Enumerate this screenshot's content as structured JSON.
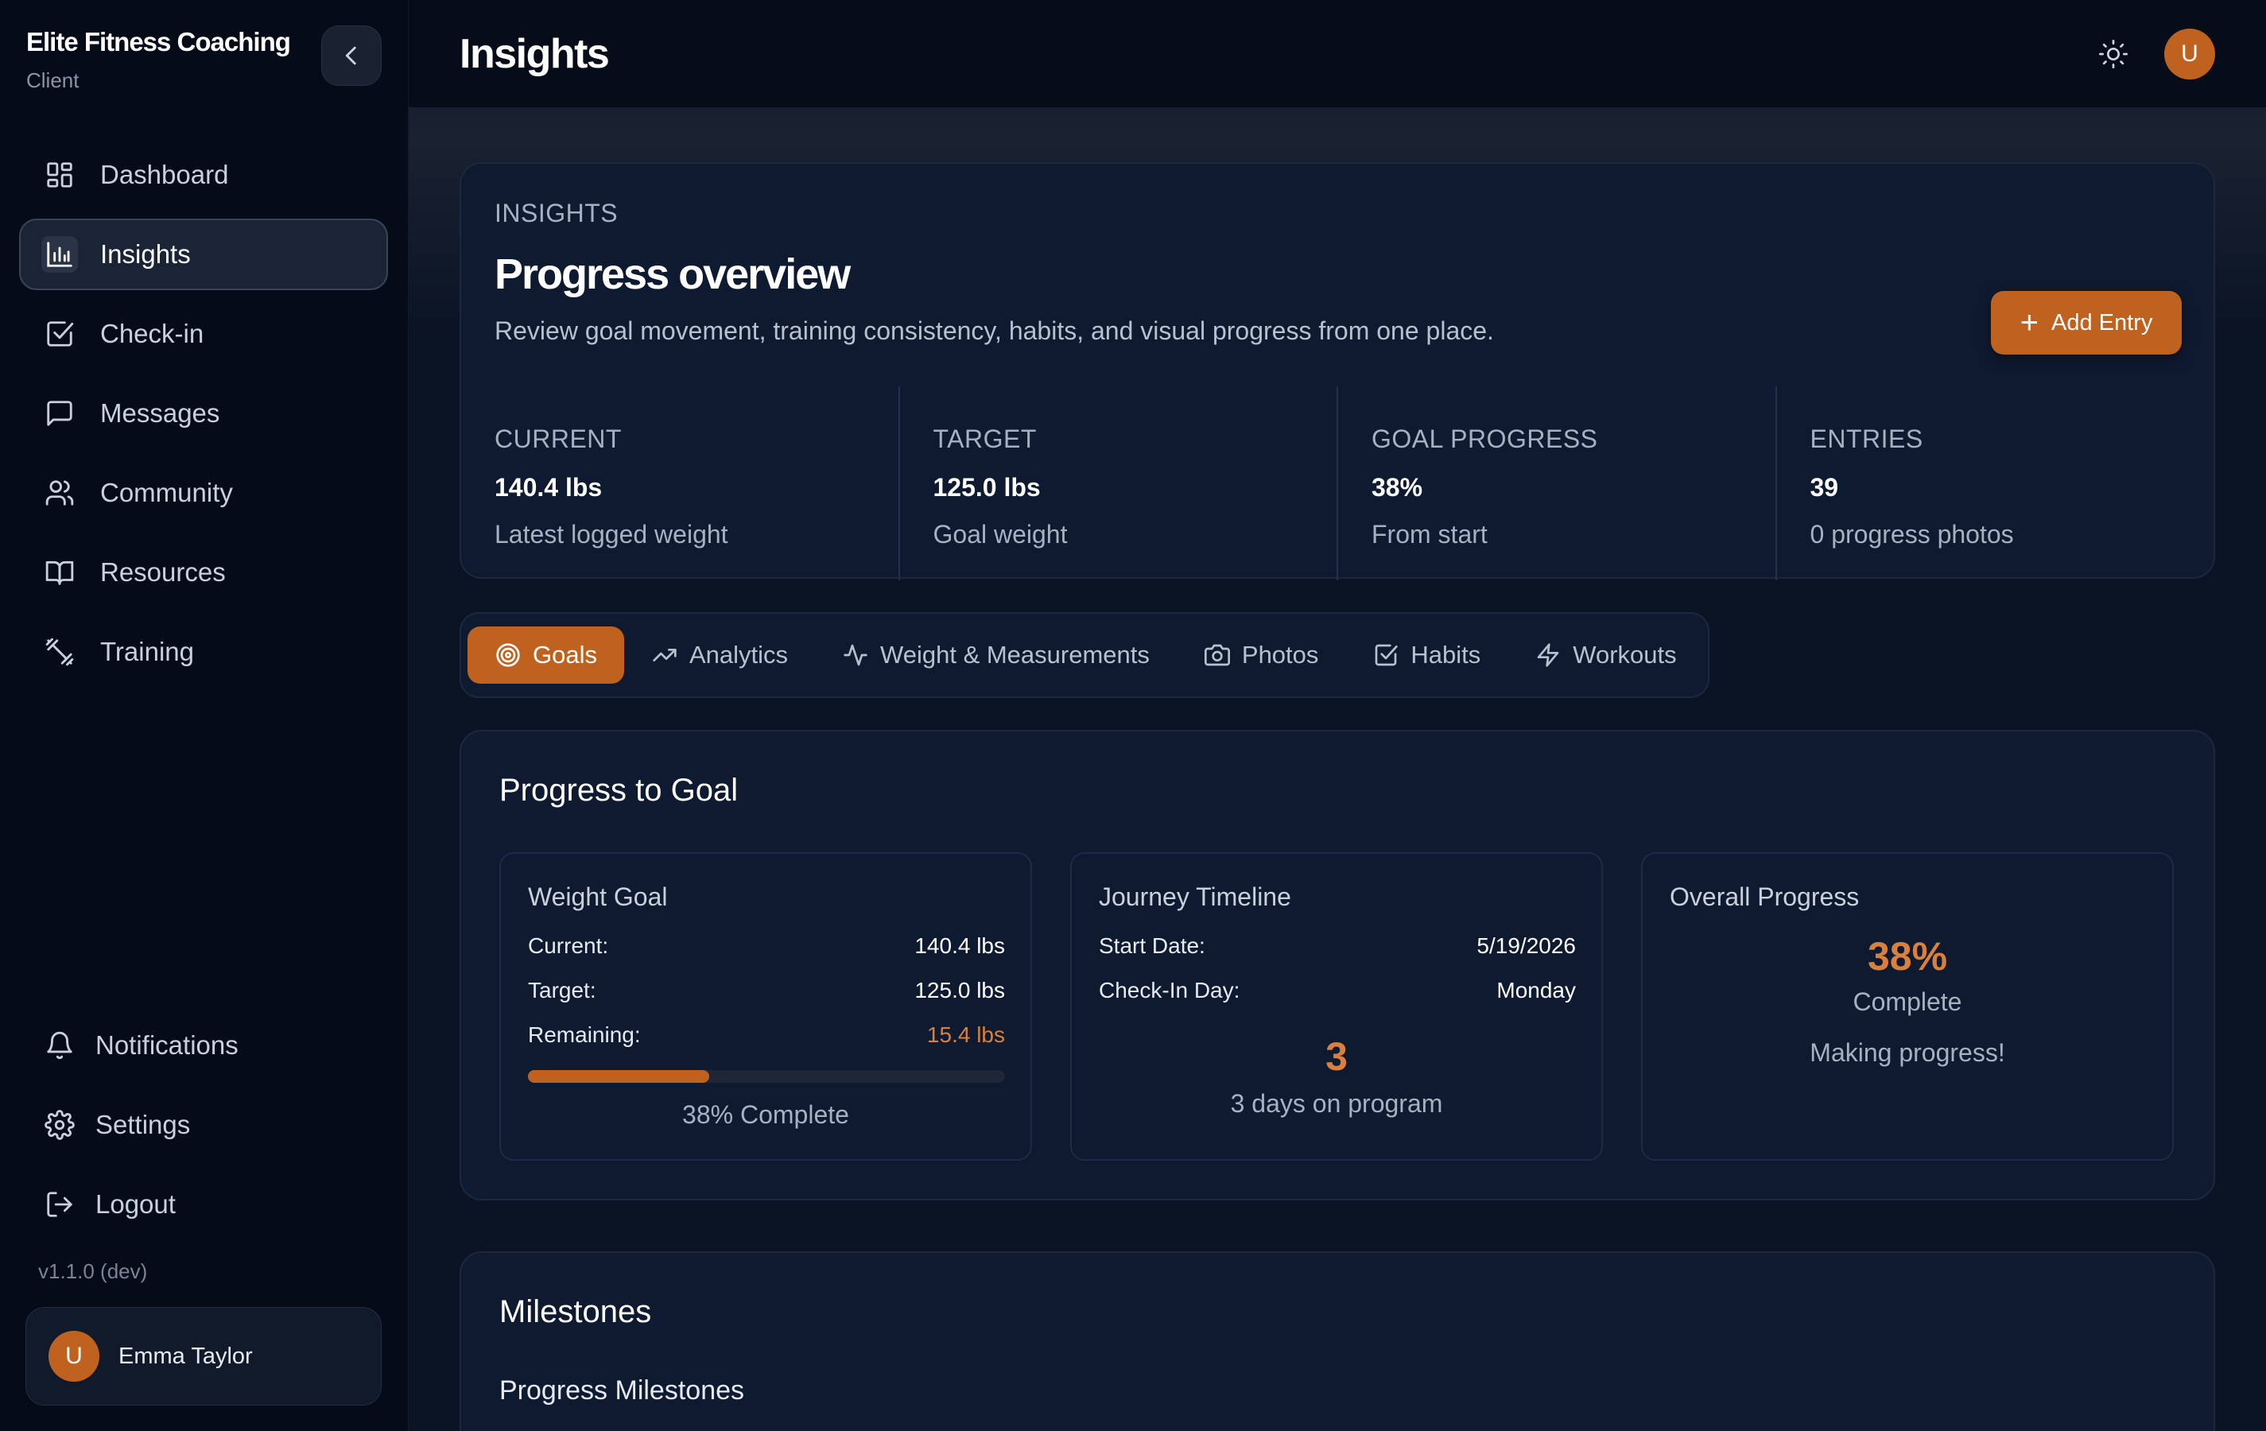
{
  "brand": {
    "name": "Elite Fitness Coaching",
    "role": "Client"
  },
  "sidebar": {
    "items": [
      {
        "label": "Dashboard",
        "icon": "dashboard-icon"
      },
      {
        "label": "Insights",
        "icon": "bar-chart-icon",
        "active": true
      },
      {
        "label": "Check-in",
        "icon": "checkbox-icon"
      },
      {
        "label": "Messages",
        "icon": "message-icon"
      },
      {
        "label": "Community",
        "icon": "users-icon"
      },
      {
        "label": "Resources",
        "icon": "book-icon"
      },
      {
        "label": "Training",
        "icon": "dumbbell-icon"
      }
    ],
    "bottom_items": [
      {
        "label": "Notifications",
        "icon": "bell-icon"
      },
      {
        "label": "Settings",
        "icon": "gear-icon"
      },
      {
        "label": "Logout",
        "icon": "logout-icon"
      }
    ],
    "version": "v1.1.0 (dev)",
    "user": {
      "initial": "U",
      "name": "Emma Taylor"
    }
  },
  "header": {
    "title": "Insights",
    "avatar_initial": "U"
  },
  "overview": {
    "eyebrow": "INSIGHTS",
    "title": "Progress overview",
    "description": "Review goal movement, training consistency, habits, and visual progress from one place.",
    "add_button": "Add Entry",
    "stats": [
      {
        "label": "CURRENT",
        "value": "140.4 lbs",
        "sub": "Latest logged weight"
      },
      {
        "label": "TARGET",
        "value": "125.0 lbs",
        "sub": "Goal weight"
      },
      {
        "label": "GOAL PROGRESS",
        "value": "38%",
        "sub": "From start"
      },
      {
        "label": "ENTRIES",
        "value": "39",
        "sub": "0 progress photos"
      }
    ]
  },
  "tabs": [
    {
      "label": "Goals",
      "icon": "target-icon",
      "active": true
    },
    {
      "label": "Analytics",
      "icon": "trending-up-icon"
    },
    {
      "label": "Weight & Measurements",
      "icon": "activity-icon"
    },
    {
      "label": "Photos",
      "icon": "camera-icon"
    },
    {
      "label": "Habits",
      "icon": "checkbox-icon"
    },
    {
      "label": "Workouts",
      "icon": "lightning-icon"
    }
  ],
  "goal": {
    "title": "Progress to Goal",
    "weight_goal": {
      "title": "Weight Goal",
      "current_label": "Current:",
      "current_value": "140.4 lbs",
      "target_label": "Target:",
      "target_value": "125.0 lbs",
      "remaining_label": "Remaining:",
      "remaining_value": "15.4 lbs",
      "progress_fraction": 0.38,
      "progress_text": "38% Complete"
    },
    "timeline": {
      "title": "Journey Timeline",
      "start_label": "Start Date:",
      "start_value": "5/19/2026",
      "checkin_label": "Check-In Day:",
      "checkin_value": "Monday",
      "days": "3",
      "days_text": "3 days on program"
    },
    "overall": {
      "title": "Overall Progress",
      "percent": "38%",
      "complete": "Complete",
      "message": "Making progress!"
    }
  },
  "milestones": {
    "title": "Milestones",
    "subtitle": "Progress Milestones"
  },
  "colors": {
    "accent": "#c0621f",
    "accent_text": "#d9803f",
    "sidebar_bg": "#050b17",
    "card_bg": "#0e1a2f"
  }
}
